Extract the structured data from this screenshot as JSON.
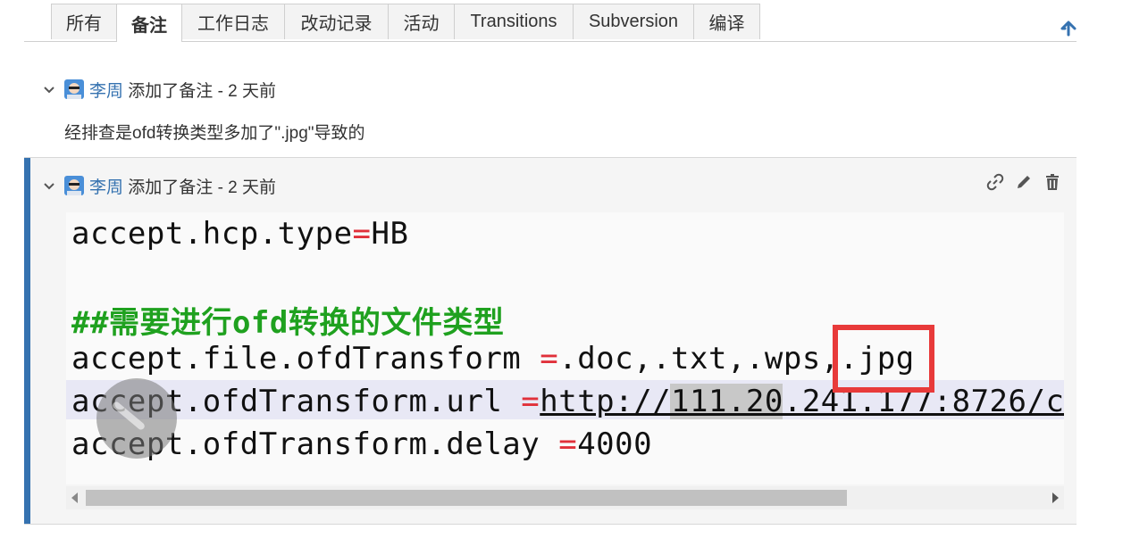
{
  "tabs": [
    {
      "label": "所有",
      "active": false
    },
    {
      "label": "备注",
      "active": true
    },
    {
      "label": "工作日志",
      "active": false
    },
    {
      "label": "改动记录",
      "active": false
    },
    {
      "label": "活动",
      "active": false
    },
    {
      "label": "Transitions",
      "active": false
    },
    {
      "label": "Subversion",
      "active": false
    },
    {
      "label": "编译",
      "active": false
    }
  ],
  "comments": [
    {
      "author": "李周",
      "action": " 添加了备注 - 2 天前",
      "body": "经排查是ofd转换类型多加了\".jpg\"导致的"
    },
    {
      "author": "李周",
      "action": " 添加了备注 - 2 天前"
    }
  ],
  "code_image": {
    "lines": [
      {
        "pre": "accept.hcp.type",
        "eq": "=",
        "post": "HB"
      },
      {
        "comment": "##需要进行ofd转换的文件类型"
      },
      {
        "pre": "accept.file.ofdTransform ",
        "eq": "=",
        "post": ".doc,.txt,.wps,.jpg"
      },
      {
        "pre": "accept.ofdTransform.url ",
        "eq": "=",
        "post": "http://111.20.241.177:8726/c"
      },
      {
        "pre": "accept.ofdTransform.delay ",
        "eq": "=",
        "post": "4000"
      }
    ]
  },
  "icons": {
    "collapse": "chevron-down-icon",
    "avatar": "user-avatar-icon",
    "permalink": "link-icon",
    "edit": "pencil-icon",
    "delete": "trash-icon",
    "scroll_top": "arrow-up-icon"
  },
  "colors": {
    "accent": "#3572b0",
    "highlight_box": "#e83a3a",
    "code_comment": "#1fa11f",
    "code_equals": "#e0303a"
  }
}
